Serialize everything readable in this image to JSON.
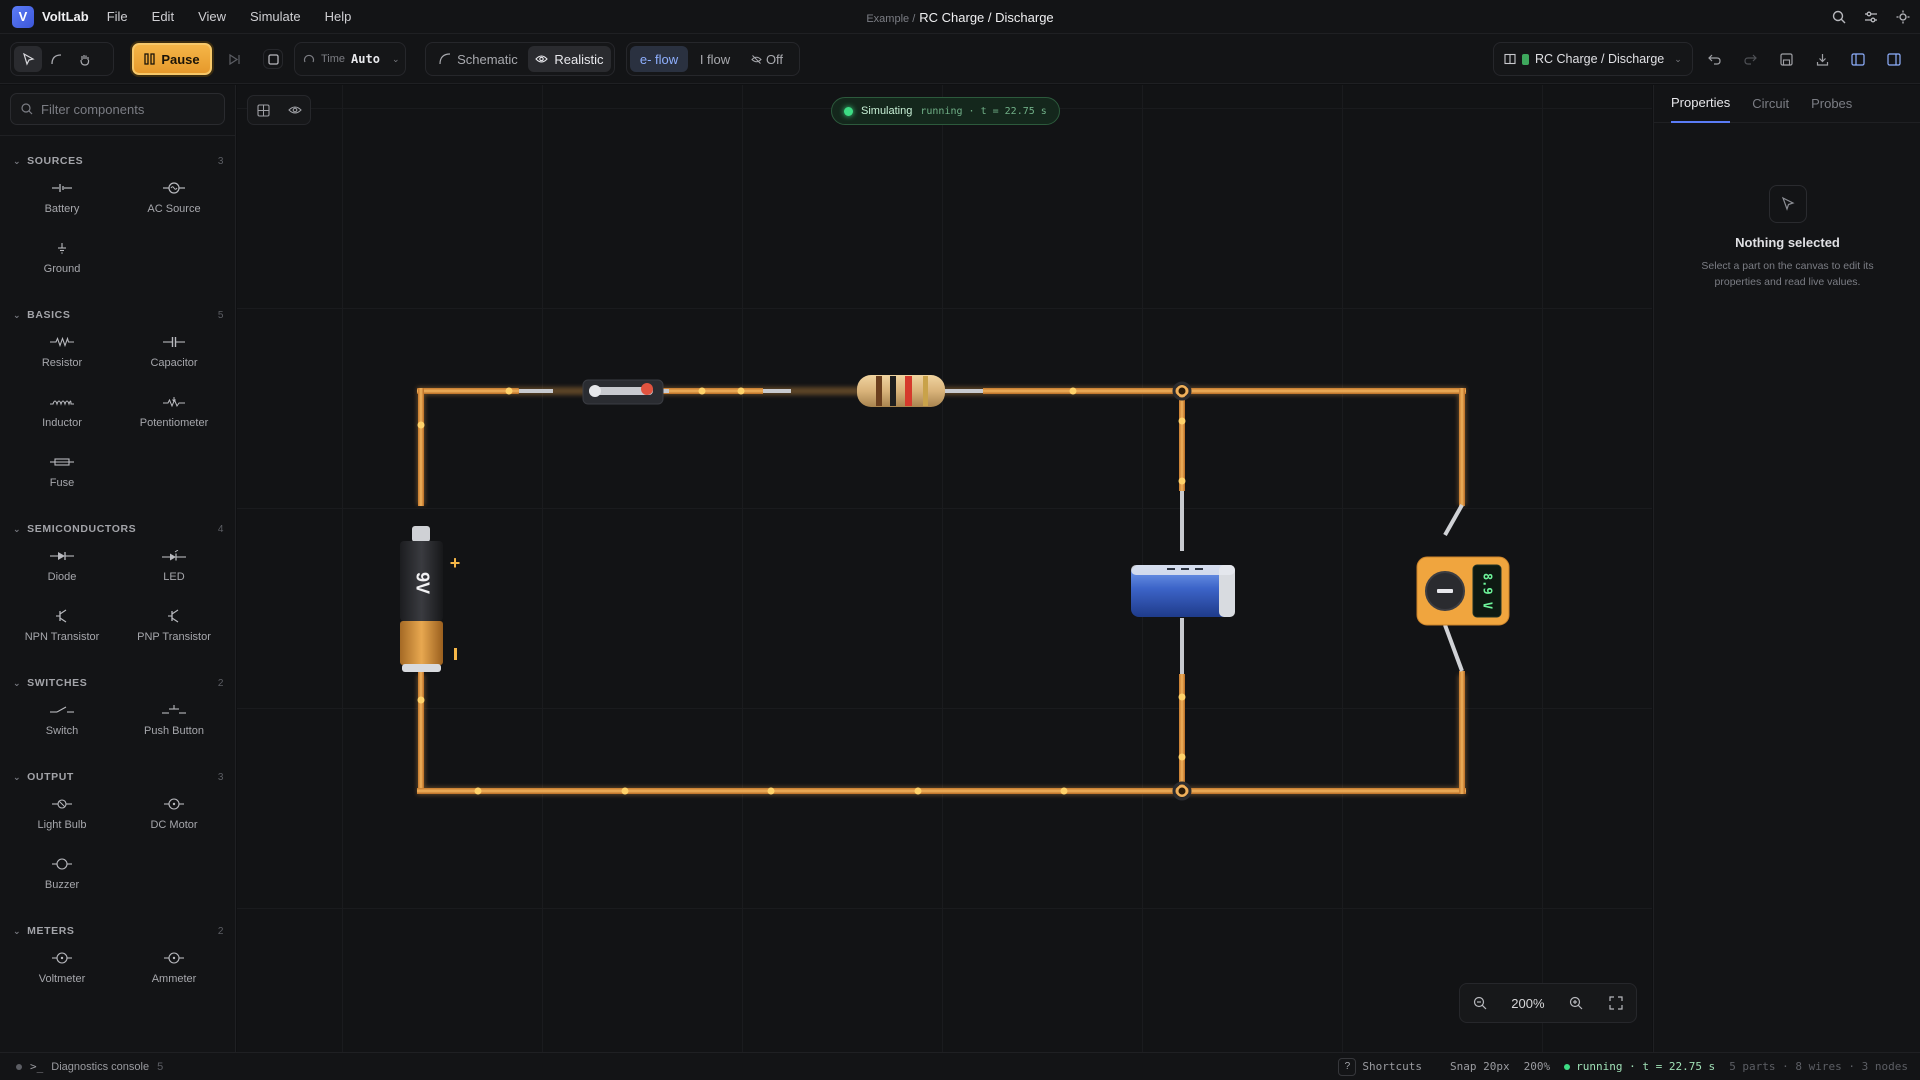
{
  "app": {
    "name": "VoltLab",
    "menus": [
      "File",
      "Edit",
      "View",
      "Simulate",
      "Help"
    ],
    "breadcrumb": "Example /",
    "title": "RC Charge / Discharge"
  },
  "toolbar": {
    "pause_label": "Pause",
    "time_label": "Time",
    "time_value": "Auto",
    "view_schematic": "Schematic",
    "view_realistic": "Realistic",
    "flow_electron": "e- flow",
    "flow_current": "I flow",
    "flow_off": "Off",
    "project_name": "RC Charge / Discharge",
    "active_view": "Realistic",
    "active_flow": "e- flow"
  },
  "sidebar": {
    "filter_placeholder": "Filter components",
    "sections": [
      {
        "name": "SOURCES",
        "count": "3",
        "items": [
          "Battery",
          "AC Source",
          "Ground"
        ]
      },
      {
        "name": "BASICS",
        "count": "5",
        "items": [
          "Resistor",
          "Capacitor",
          "Inductor",
          "Potentiometer",
          "Fuse"
        ]
      },
      {
        "name": "SEMICONDUCTORS",
        "count": "4",
        "items": [
          "Diode",
          "LED",
          "NPN Transistor",
          "PNP Transistor"
        ]
      },
      {
        "name": "SWITCHES",
        "count": "2",
        "items": [
          "Switch",
          "Push Button"
        ]
      },
      {
        "name": "OUTPUT",
        "count": "3",
        "items": [
          "Light Bulb",
          "DC Motor",
          "Buzzer"
        ]
      },
      {
        "name": "METERS",
        "count": "2",
        "items": [
          "Voltmeter",
          "Ammeter"
        ]
      }
    ]
  },
  "canvas": {
    "status_label": "Simulating",
    "status_detail": "running · t = 22.75 s",
    "battery_label": "9V",
    "battery_plus": "+",
    "meter_reading": "8.9 V",
    "zoom": "200%",
    "wire_color": "#e8a04a",
    "status_color": "#3ddc84"
  },
  "rightpanel": {
    "tabs": [
      "Properties",
      "Circuit",
      "Probes"
    ],
    "active_tab": "Properties",
    "empty_title": "Nothing selected",
    "empty_text": "Select a part on the canvas to edit its properties and read live values."
  },
  "statusbar": {
    "console_label": "Diagnostics console",
    "console_count": "5",
    "shortcuts_key": "?",
    "shortcuts_label": "Shortcuts",
    "snap": "Snap 20px",
    "zoom": "200%",
    "run_status": "running · t = 22.75 s",
    "summary": "5 parts · 8 wires · 3 nodes"
  }
}
